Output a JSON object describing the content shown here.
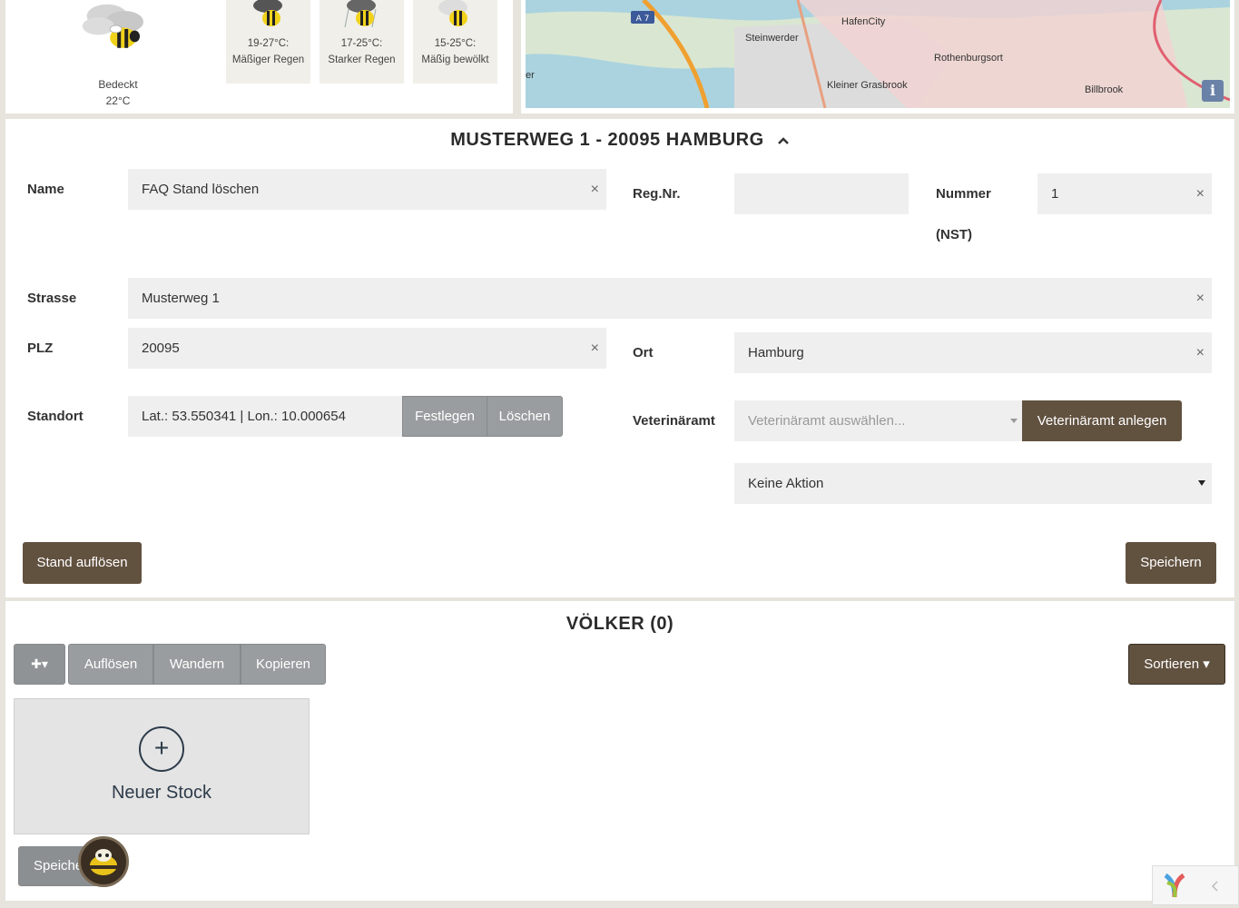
{
  "weather": {
    "main": {
      "condition": "Bedeckt",
      "temp": "22°C"
    },
    "forecast": [
      {
        "range": "19-27°C:",
        "condition": "Mäßiger Regen"
      },
      {
        "range": "17-25°C:",
        "condition": "Starker Regen"
      },
      {
        "range": "15-25°C:",
        "condition": "Mäßig bewölkt"
      }
    ]
  },
  "map": {
    "labels": [
      "HafenCity",
      "Steinwerder",
      "Rothenburgsort",
      "Kleiner Grasbrook",
      "Billbrook",
      "A 7",
      "er"
    ],
    "info_glyph": "i"
  },
  "stand": {
    "title": "MUSTERWEG 1 - 20095 HAMBURG",
    "name_label": "Name",
    "name_value": "FAQ Stand löschen",
    "regnr_label": "Reg.Nr.",
    "regnr_value": "",
    "nummer_label": "Nummer",
    "nummer_sub": "(NST)",
    "nummer_value": "1",
    "strasse_label": "Strasse",
    "strasse_value": "Musterweg 1",
    "plz_label": "PLZ",
    "plz_value": "20095",
    "ort_label": "Ort",
    "ort_value": "Hamburg",
    "standort_label": "Standort",
    "standort_value": "Lat.: 53.550341 | Lon.: 10.000654",
    "festlegen": "Festlegen",
    "loeschen": "Löschen",
    "vet_label": "Veterinäramt",
    "vet_placeholder": "Veterinäramt auswählen...",
    "vet_add": "Veterinäramt anlegen",
    "aktion_value": "Keine Aktion",
    "aufloesen": "Stand auflösen",
    "speichern": "Speichern",
    "clear_glyph": "×"
  },
  "voelker": {
    "title": "VÖLKER (0)",
    "add_btn": "✚▾",
    "btn_aufloesen": "Auflösen",
    "btn_wandern": "Wandern",
    "btn_kopieren": "Kopieren",
    "sortieren": "Sortieren ▾",
    "new_stock": "Neuer Stock",
    "plus": "+",
    "speichern_partial": "Speiche"
  },
  "colors": {
    "brown": "#61513f",
    "gray_btn": "#9a9d9f",
    "bee_yellow": "#f1d21b"
  }
}
